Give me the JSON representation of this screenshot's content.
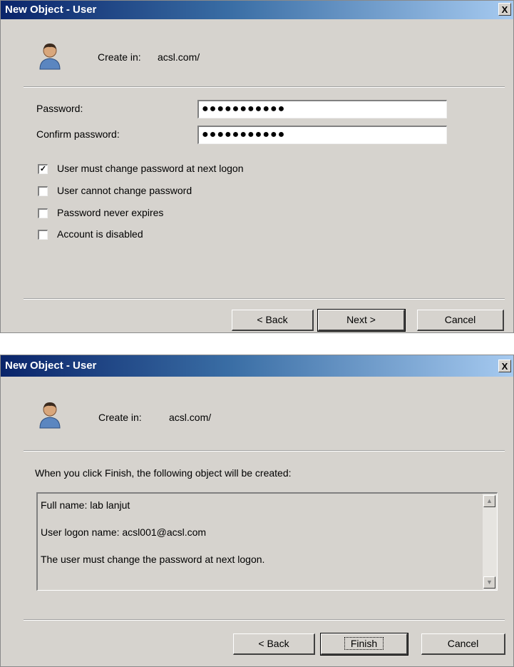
{
  "dialog1": {
    "title": "New Object - User",
    "close_label": "X",
    "create_in_label": "Create in:",
    "create_in_value": "acsl.com/",
    "password_label": "Password:",
    "password_value": "●●●●●●●●●●●",
    "confirm_label": "Confirm password:",
    "confirm_value": "●●●●●●●●●●●",
    "checkboxes": [
      {
        "label": "User must change password at next logon",
        "checked": true
      },
      {
        "label": "User cannot change password",
        "checked": false
      },
      {
        "label": "Password never expires",
        "checked": false
      },
      {
        "label": "Account is disabled",
        "checked": false
      }
    ],
    "buttons": {
      "back": "< Back",
      "next": "Next >",
      "cancel": "Cancel"
    }
  },
  "dialog2": {
    "title": "New Object - User",
    "close_label": "X",
    "create_in_label": "Create in:",
    "create_in_value": "acsl.com/",
    "info": "When you click Finish, the following object will be created:",
    "summary": [
      "Full name: lab lanjut",
      "User logon name: acsl001@acsl.com",
      "The user must change the password at next logon."
    ],
    "scroll_up_icon": "arrow-up",
    "scroll_down_icon": "arrow-down",
    "buttons": {
      "back": "< Back",
      "finish": "Finish",
      "cancel": "Cancel"
    }
  },
  "colors": {
    "title_start": "#0a246a",
    "title_end": "#a6caf0",
    "dialog_bg": "#d6d3ce"
  }
}
